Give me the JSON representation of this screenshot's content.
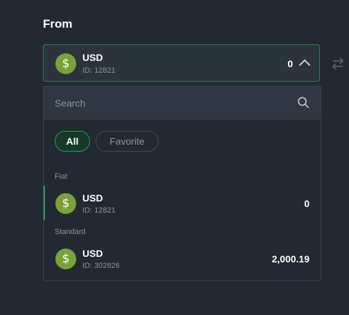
{
  "from_section": {
    "title": "From"
  },
  "selected_account": {
    "currency": "USD",
    "id_text": "ID: 12821",
    "balance": "0",
    "icon": "dollar-coin-icon",
    "icon_glyph": "$"
  },
  "dropdown": {
    "search": {
      "placeholder": "Search",
      "value": ""
    },
    "filters": [
      {
        "label": "All",
        "active": true
      },
      {
        "label": "Favorite",
        "active": false
      }
    ],
    "groups": [
      {
        "label": "Fiat",
        "accounts": [
          {
            "currency": "USD",
            "id_text": "ID: 12821",
            "balance": "0",
            "icon_glyph": "$",
            "selected": true
          }
        ]
      },
      {
        "label": "Standard",
        "accounts": [
          {
            "currency": "USD",
            "id_text": "ID: 302826",
            "balance": "2,000.19",
            "icon_glyph": "$",
            "selected": false
          }
        ]
      }
    ]
  },
  "colors": {
    "background": "#232932",
    "accent_green": "#2aa05a",
    "coin_green": "#7aa23a",
    "muted_text": "#8a939c"
  }
}
